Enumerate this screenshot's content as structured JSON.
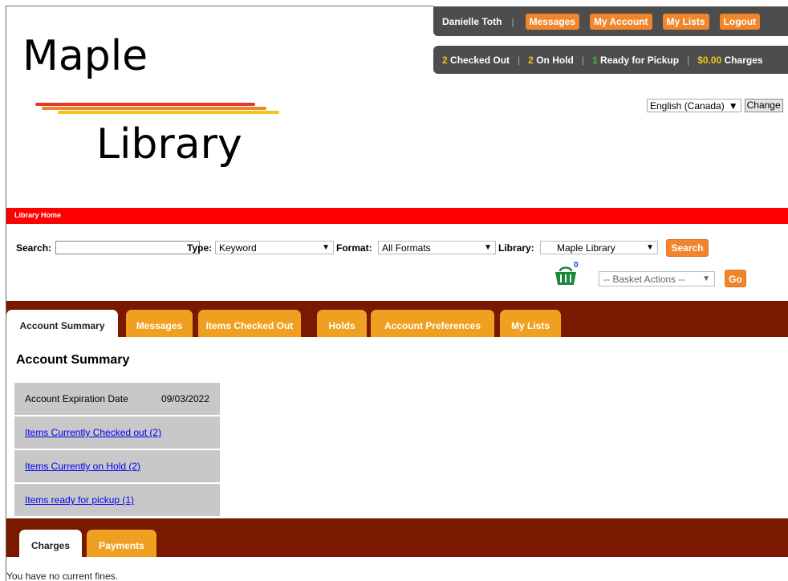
{
  "logo": {
    "line1": "Maple",
    "line2": "Library"
  },
  "user": {
    "name": "Danielle Toth",
    "buttons": {
      "messages": "Messages",
      "account": "My Account",
      "lists": "My Lists",
      "logout": "Logout"
    }
  },
  "status": {
    "checked_out_count": "2",
    "checked_out_label": "Checked Out",
    "on_hold_count": "2",
    "on_hold_label": "On Hold",
    "ready_count": "1",
    "ready_label": "Ready for Pickup",
    "charges_amount": "$0.00",
    "charges_label": "Charges"
  },
  "language": {
    "selected": "English (Canada)",
    "change_label": "Change"
  },
  "nav": {
    "home": "Library Home"
  },
  "search": {
    "search_label": "Search:",
    "query": "",
    "type_label": "Type:",
    "type_value": "Keyword",
    "format_label": "Format:",
    "format_value": "All Formats",
    "library_label": "Library:",
    "library_value": "Maple Library",
    "button": "Search"
  },
  "basket": {
    "count": "0",
    "actions": "-- Basket Actions --",
    "go": "Go"
  },
  "tabs": [
    "Account Summary",
    "Messages",
    "Items Checked Out",
    "Holds",
    "Account Preferences",
    "My Lists"
  ],
  "page_title": "Account Summary",
  "summary": {
    "expiration_label": "Account Expiration Date",
    "expiration_value": "09/03/2022",
    "checked_out_link": "Items Currently Checked out (2)",
    "on_hold_link": "Items Currently on Hold (2)",
    "ready_link": "Items ready for pickup (1)"
  },
  "charge_tabs": [
    "Charges",
    "Payments"
  ],
  "no_fines": "You have no current fines.",
  "colors": {
    "accent_orange": "#f0852b",
    "tab_orange": "#f0a020",
    "tabbar_bg": "#7a1900",
    "header_red": "#ff0000",
    "bar_gray": "#4d4d4d"
  }
}
